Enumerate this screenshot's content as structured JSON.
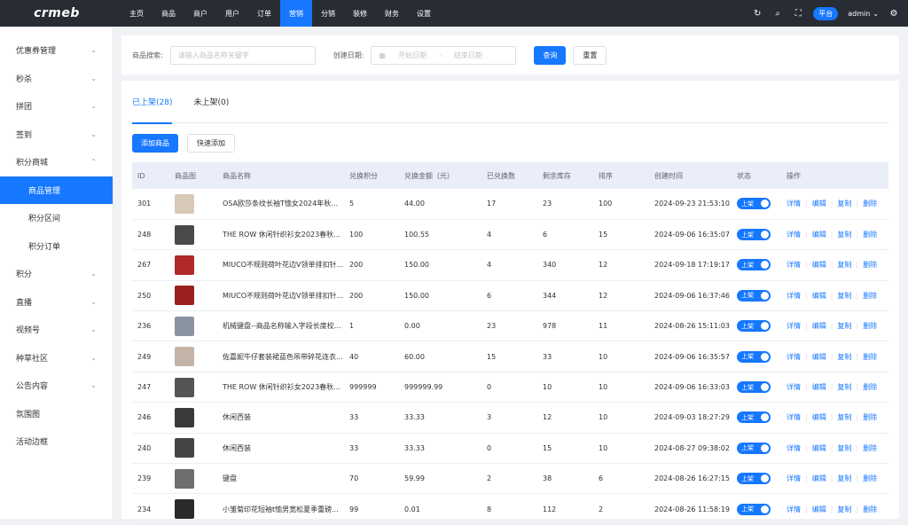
{
  "logo": "crmeb",
  "nav": [
    "主页",
    "商品",
    "商户",
    "用户",
    "订单",
    "营销",
    "分销",
    "装修",
    "财务",
    "设置"
  ],
  "nav_active": 5,
  "topbar": {
    "platform": "平台",
    "user": "admin"
  },
  "sidebar": [
    {
      "label": "优惠券管理",
      "chev": "⌄"
    },
    {
      "label": "秒杀",
      "chev": "⌄"
    },
    {
      "label": "拼团",
      "chev": "⌄"
    },
    {
      "label": "签到",
      "chev": "⌄"
    },
    {
      "label": "积分商城",
      "chev": "⌃"
    },
    {
      "label": "商品管理",
      "sub": true,
      "active": true
    },
    {
      "label": "积分区间",
      "sub": true
    },
    {
      "label": "积分订单",
      "sub": true
    },
    {
      "label": "积分",
      "chev": "⌄"
    },
    {
      "label": "直播",
      "chev": "⌄"
    },
    {
      "label": "视频号",
      "chev": "⌄"
    },
    {
      "label": "种草社区",
      "chev": "⌄"
    },
    {
      "label": "公告内容",
      "chev": "⌄"
    },
    {
      "label": "氛围图"
    },
    {
      "label": "活动边框"
    }
  ],
  "search": {
    "product_label": "商品搜索:",
    "product_placeholder": "请输入商品名称关键字",
    "date_label": "创建日期:",
    "date_start": "开始日期",
    "date_sep": "-",
    "date_end": "结束日期",
    "query_btn": "查询",
    "reset_btn": "重置"
  },
  "tabs": [
    "已上架(28)",
    "未上架(0)"
  ],
  "buttons": {
    "add": "添加商品",
    "quick_add": "快速添加"
  },
  "columns": [
    "ID",
    "商品图",
    "商品名称",
    "兑换积分",
    "兑换金额（元）",
    "已兑换数",
    "剩余库存",
    "排序",
    "创建时间",
    "状态",
    "操作"
  ],
  "rows": [
    {
      "id": "301",
      "name": "OSA欧莎条纹长袖T恤女2024年秋冬...",
      "points": "5",
      "amount": "44.00",
      "sold": "17",
      "stock": "23",
      "sort": "100",
      "time": "2024-09-23 21:53:10",
      "status": "上架",
      "color": "#d8c8b8"
    },
    {
      "id": "248",
      "name": "THE ROW 休闲针织衫女2023春秋...",
      "points": "100",
      "amount": "100.55",
      "sold": "4",
      "stock": "6",
      "sort": "15",
      "time": "2024-09-06 16:35:07",
      "status": "上架",
      "color": "#4a4a4a"
    },
    {
      "id": "267",
      "name": "MIUCO不规则荷叶花边V领单排扣针...",
      "points": "200",
      "amount": "150.00",
      "sold": "4",
      "stock": "340",
      "sort": "12",
      "time": "2024-09-18 17:19:17",
      "status": "上架",
      "color": "#b02a2a"
    },
    {
      "id": "250",
      "name": "MIUCO不规则荷叶花边V领单排扣针...",
      "points": "200",
      "amount": "150.00",
      "sold": "6",
      "stock": "344",
      "sort": "12",
      "time": "2024-09-06 16:37:46",
      "status": "上架",
      "color": "#9a2020"
    },
    {
      "id": "236",
      "name": "机械键盘--商品名称输入字段长度校...",
      "points": "1",
      "amount": "0.00",
      "sold": "23",
      "stock": "978",
      "sort": "11",
      "time": "2024-08-26 15:11:03",
      "status": "上架",
      "color": "#8a94a0"
    },
    {
      "id": "249",
      "name": "佐嘉妮牛仔套装裙蓝色吊带碎花连衣...",
      "points": "40",
      "amount": "60.00",
      "sold": "15",
      "stock": "33",
      "sort": "10",
      "time": "2024-09-06 16:35:57",
      "status": "上架",
      "color": "#c4b4a8"
    },
    {
      "id": "247",
      "name": "THE ROW 休闲针织衫女2023春秋...",
      "points": "999999",
      "amount": "999999.99",
      "sold": "0",
      "stock": "10",
      "sort": "10",
      "time": "2024-09-06 16:33:03",
      "status": "上架",
      "color": "#555555"
    },
    {
      "id": "246",
      "name": "休闲西装",
      "points": "33",
      "amount": "33.33",
      "sold": "3",
      "stock": "12",
      "sort": "10",
      "time": "2024-09-03 18:27:29",
      "status": "上架",
      "color": "#3a3a3a"
    },
    {
      "id": "240",
      "name": "休闲西装",
      "points": "33",
      "amount": "33.33",
      "sold": "0",
      "stock": "15",
      "sort": "10",
      "time": "2024-08-27 09:38:02",
      "status": "上架",
      "color": "#444444"
    },
    {
      "id": "239",
      "name": "键盘",
      "points": "70",
      "amount": "59.99",
      "sold": "2",
      "stock": "38",
      "sort": "6",
      "time": "2024-08-26 16:27:15",
      "status": "上架",
      "color": "#6e6e6e"
    },
    {
      "id": "234",
      "name": "小雏菊印花短袖t恤男宽松夏季重磅...",
      "points": "99",
      "amount": "0.01",
      "sold": "8",
      "stock": "112",
      "sort": "2",
      "time": "2024-08-26 11:58:19",
      "status": "上架",
      "color": "#2a2a2a"
    }
  ],
  "row_ops": [
    "详情",
    "编辑",
    "复制",
    "删除"
  ]
}
